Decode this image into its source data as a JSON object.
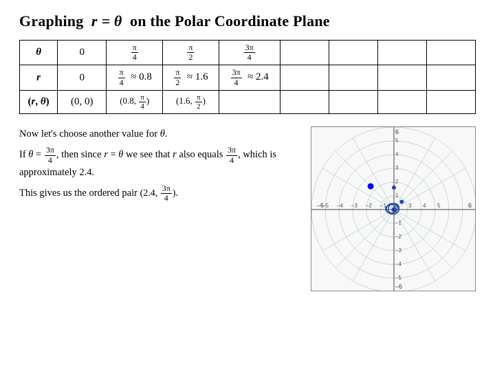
{
  "title": {
    "prefix": "Graphing",
    "equation": "r = θ",
    "suffix": "on the Polar Coordinate Plane"
  },
  "table": {
    "rows": [
      {
        "label": "θ",
        "values": [
          "0",
          "π/4",
          "π/2",
          "3π/4"
        ],
        "extra_cols": [
          "",
          "",
          "",
          ""
        ]
      },
      {
        "label": "r",
        "values": [
          "0",
          "π/4 ≈ 0.8",
          "π/2 ≈ 1.6",
          "3π/4 ≈ 2.4"
        ],
        "extra_cols": [
          "",
          "",
          "",
          ""
        ]
      },
      {
        "label": "(r, θ)",
        "values": [
          "(0, 0)",
          "(0.8, π/4)",
          "(1.6, π/2)",
          ""
        ],
        "extra_cols": []
      }
    ]
  },
  "text": {
    "choose": "Now let's choose another value for θ.",
    "if_line1": "If θ = 3π/4, then since r = θ we see that r",
    "if_line2": "also equals 3π/4, which is approximately 2.4.",
    "if_line3": "This gives us the ordered pair (2.4, 3π/4)."
  },
  "plot": {
    "max_r": 6,
    "point": {
      "r": 2.4,
      "theta_deg": 135
    }
  }
}
